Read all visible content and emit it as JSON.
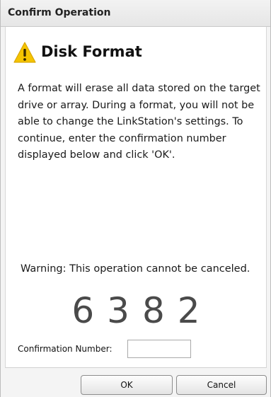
{
  "window": {
    "title": "Confirm Operation"
  },
  "dialog": {
    "heading": "Disk Format",
    "message": "A format will erase all data stored on the target drive or array. During a format, you will not be able to change the LinkStation's settings. To continue, enter the confirmation number displayed below and click 'OK'.",
    "warning": "Warning: This operation cannot be canceled.",
    "confirmation_code": "6382",
    "confirmation_label": "Confirmation Number:",
    "confirmation_value": "",
    "icon": "warning-icon",
    "icon_color": "#f5c400"
  },
  "buttons": {
    "ok_label": "OK",
    "cancel_label": "Cancel"
  }
}
